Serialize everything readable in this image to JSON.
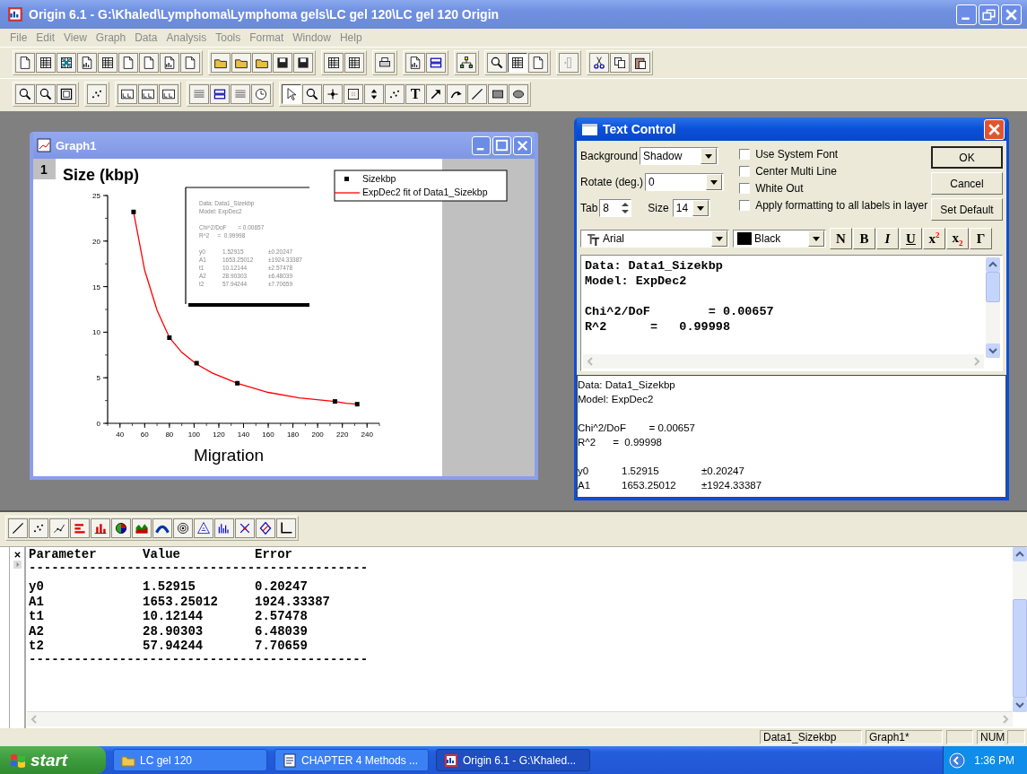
{
  "window": {
    "title": "Origin 6.1 - G:\\Khaled\\Lymphoma\\Lymphoma gels\\LC gel 120\\LC gel 120 Origin"
  },
  "menu": [
    "File",
    "Edit",
    "View",
    "Graph",
    "Data",
    "Analysis",
    "Tools",
    "Format",
    "Window",
    "Help"
  ],
  "draw_tools": [
    {
      "selected": true
    },
    {
      "selected": false
    },
    {
      "selected": false
    },
    {
      "selected": false
    },
    {
      "selected": false
    },
    {
      "selected": false
    },
    {
      "label": "T",
      "selected": false
    },
    {
      "selected": false
    },
    {
      "selected": false
    },
    {
      "selected": false
    },
    {
      "selected": false
    },
    {
      "selected": false
    }
  ],
  "graph_window": {
    "title": "Graph1",
    "layer": "1",
    "fit_label": {
      "header": [
        "Data: Data1_Sizekbp",
        "Model: ExpDec2"
      ],
      "stats": [
        "Chi^2/DoF       = 0.00657",
        "R^2     =  0.99998"
      ],
      "params": [
        [
          "y0",
          "1.52915",
          "±0.20247"
        ],
        [
          "A1",
          "1653.25012",
          "±1924.33387"
        ],
        [
          "t1",
          "10.12144",
          "±2.57478"
        ],
        [
          "A2",
          "28.90303",
          "±6.48039"
        ],
        [
          "t2",
          "57.94244",
          "±7.70659"
        ]
      ]
    },
    "chart_data": {
      "type": "line",
      "xlabel": "Migration",
      "ylabel": "Size (kbp)",
      "x": [
        51,
        60,
        70,
        80,
        90,
        102,
        115,
        135,
        160,
        185,
        214,
        223,
        232
      ],
      "series": [
        {
          "name": "ExpDec2 fit of Data1_Sizekbp",
          "color": "#ff0000",
          "values": [
            23.2,
            16.8,
            12.4,
            9.4,
            7.8,
            6.5,
            5.5,
            4.4,
            3.4,
            2.8,
            2.4,
            2.2,
            2.1
          ]
        },
        {
          "name": "Sizekbp",
          "color": "#000000",
          "marker": true,
          "values": [
            23.2,
            null,
            null,
            9.4,
            null,
            6.6,
            null,
            4.4,
            null,
            null,
            2.4,
            null,
            2.1
          ]
        }
      ],
      "legend": true,
      "xlim": [
        30,
        250
      ],
      "ylim": [
        0,
        25
      ],
      "xticks": [
        40,
        60,
        80,
        100,
        120,
        140,
        160,
        180,
        200,
        220,
        240
      ],
      "yticks": [
        0,
        5,
        10,
        15,
        20,
        25
      ]
    }
  },
  "text_control": {
    "title": "Text Control",
    "background": {
      "label": "Background",
      "value": "Shadow"
    },
    "rotate": {
      "label": "Rotate (deg.)",
      "value": "0"
    },
    "tab": {
      "label": "Tab",
      "value": "8"
    },
    "size": {
      "label": "Size",
      "value": "14"
    },
    "options": [
      {
        "label": "Use System Font",
        "checked": false
      },
      {
        "label": "Center Multi Line",
        "checked": false
      },
      {
        "label": "White Out",
        "checked": false
      },
      {
        "label": "Apply formatting to all labels in layer",
        "checked": false
      }
    ],
    "buttons": [
      "OK",
      "Cancel",
      "Set Default"
    ],
    "font": "Arial",
    "font_color_label": "Black",
    "format_buttons": [
      "N",
      "B",
      "I",
      "U",
      "x$^{2}$",
      "x$_{2}$",
      "Γ"
    ],
    "editor": [
      [
        "Data: Data1_Sizekbp",
        "Model: ExpDec2"
      ],
      [
        "Chi^2/DoF        = 0.00657",
        "R^2      =   0.99998"
      ]
    ],
    "preview": {
      "header": [
        "Data: Data1_Sizekbp",
        "Model: ExpDec2"
      ],
      "stats": [
        "Chi^2/DoF        = 0.00657",
        "R^2      =  0.99998"
      ],
      "params": [
        [
          "y0",
          "1.52915",
          "±0.20247"
        ],
        [
          "A1",
          "1653.25012",
          "±1924.33387"
        ]
      ]
    }
  },
  "results": {
    "columns": [
      "Parameter",
      "Value",
      "Error"
    ],
    "rule": "---------------------------------------------",
    "rows": [
      [
        "y0",
        "1.52915",
        "0.20247"
      ],
      [
        "A1",
        "1653.25012",
        "1924.33387"
      ],
      [
        "t1",
        "10.12144",
        "2.57478"
      ],
      [
        "A2",
        "28.90303",
        "6.48039"
      ],
      [
        "t2",
        "57.94244",
        "7.70659"
      ]
    ]
  },
  "status_bar": [
    "Data1_Sizekbp",
    "Graph1*",
    "NUM"
  ],
  "taskbar": {
    "start": "start",
    "tasks": [
      {
        "label": "LC gel 120",
        "selected": false
      },
      {
        "label": "CHAPTER 4 Methods ...",
        "selected": false
      },
      {
        "label": "Origin 6.1 - G:\\Khaled...",
        "selected": true
      }
    ],
    "clock": "1:36 PM"
  }
}
